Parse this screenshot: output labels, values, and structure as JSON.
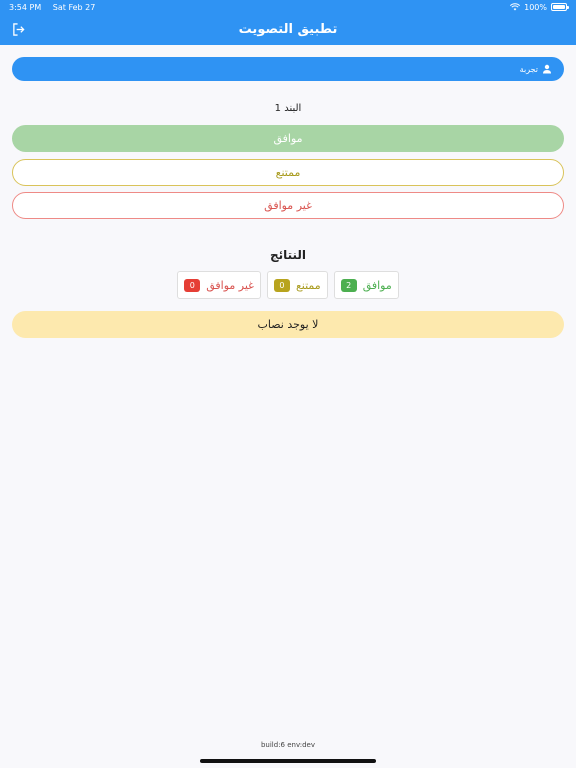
{
  "status_bar": {
    "time": "3:54 PM",
    "date": "Sat Feb 27",
    "battery": "100%"
  },
  "header": {
    "title": "تطبيق التصويت"
  },
  "user": {
    "name": "تجربة"
  },
  "item": {
    "title": "البند 1"
  },
  "vote_buttons": {
    "agree": "موافق",
    "abstain": "ممتنع",
    "disagree": "غير موافق"
  },
  "results": {
    "title": "النتائج",
    "disagree": {
      "label": "غير موافق",
      "count": "0"
    },
    "abstain": {
      "label": "ممتنع",
      "count": "0"
    },
    "agree": {
      "label": "موافق",
      "count": "2"
    }
  },
  "quorum": {
    "message": "لا يوجد نصاب"
  },
  "footer": {
    "build": "build:6 env:dev"
  },
  "icons": {
    "logout": "logout-icon",
    "user": "user-icon",
    "wifi": "wifi-icon",
    "battery": "battery-icon"
  },
  "colors": {
    "primary": "#2f93f3",
    "agree": "#4caf50",
    "abstain": "#a89a1c",
    "disagree": "#d9534f",
    "warning_bg": "#fde9ae"
  }
}
